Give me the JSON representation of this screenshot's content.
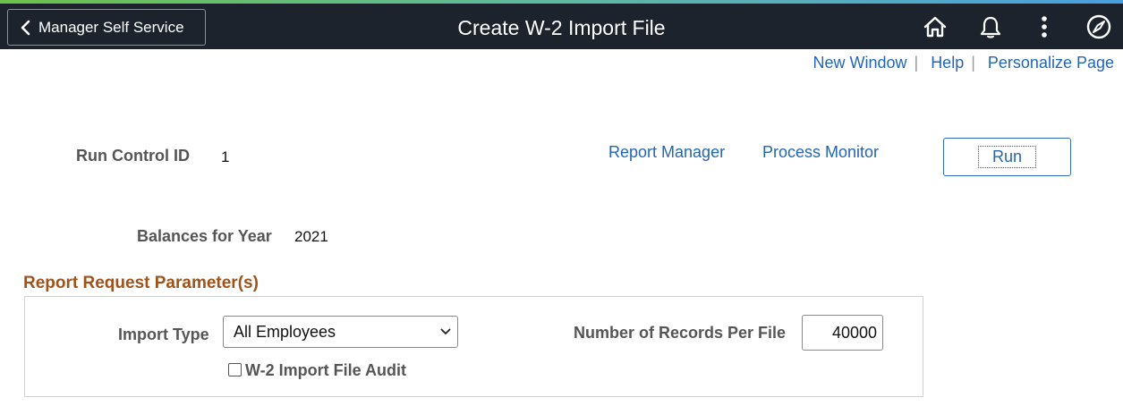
{
  "header": {
    "back_label": "Manager Self Service",
    "title": "Create W-2 Import File",
    "icons": [
      "home-icon",
      "bell-icon",
      "more-options-icon",
      "navbar-compass-icon"
    ]
  },
  "toplinks": {
    "new_window": "New Window",
    "help": "Help",
    "personalize": "Personalize Page",
    "separator": "|"
  },
  "run_control": {
    "label": "Run Control ID",
    "value": "1",
    "report_manager": "Report Manager",
    "process_monitor": "Process Monitor",
    "run_label": "Run"
  },
  "balances": {
    "label": "Balances for Year",
    "value": "2021"
  },
  "parameters": {
    "section_title": "Report Request Parameter(s)",
    "import_type_label": "Import Type",
    "import_type_value": "All Employees",
    "records_label": "Number of Records Per File",
    "records_value": "40000",
    "audit_label": "W-2 Import File Audit",
    "audit_checked": false
  },
  "colors": {
    "header_bg": "#1c232c",
    "link": "#2266b4",
    "section_title": "#a0521b"
  }
}
